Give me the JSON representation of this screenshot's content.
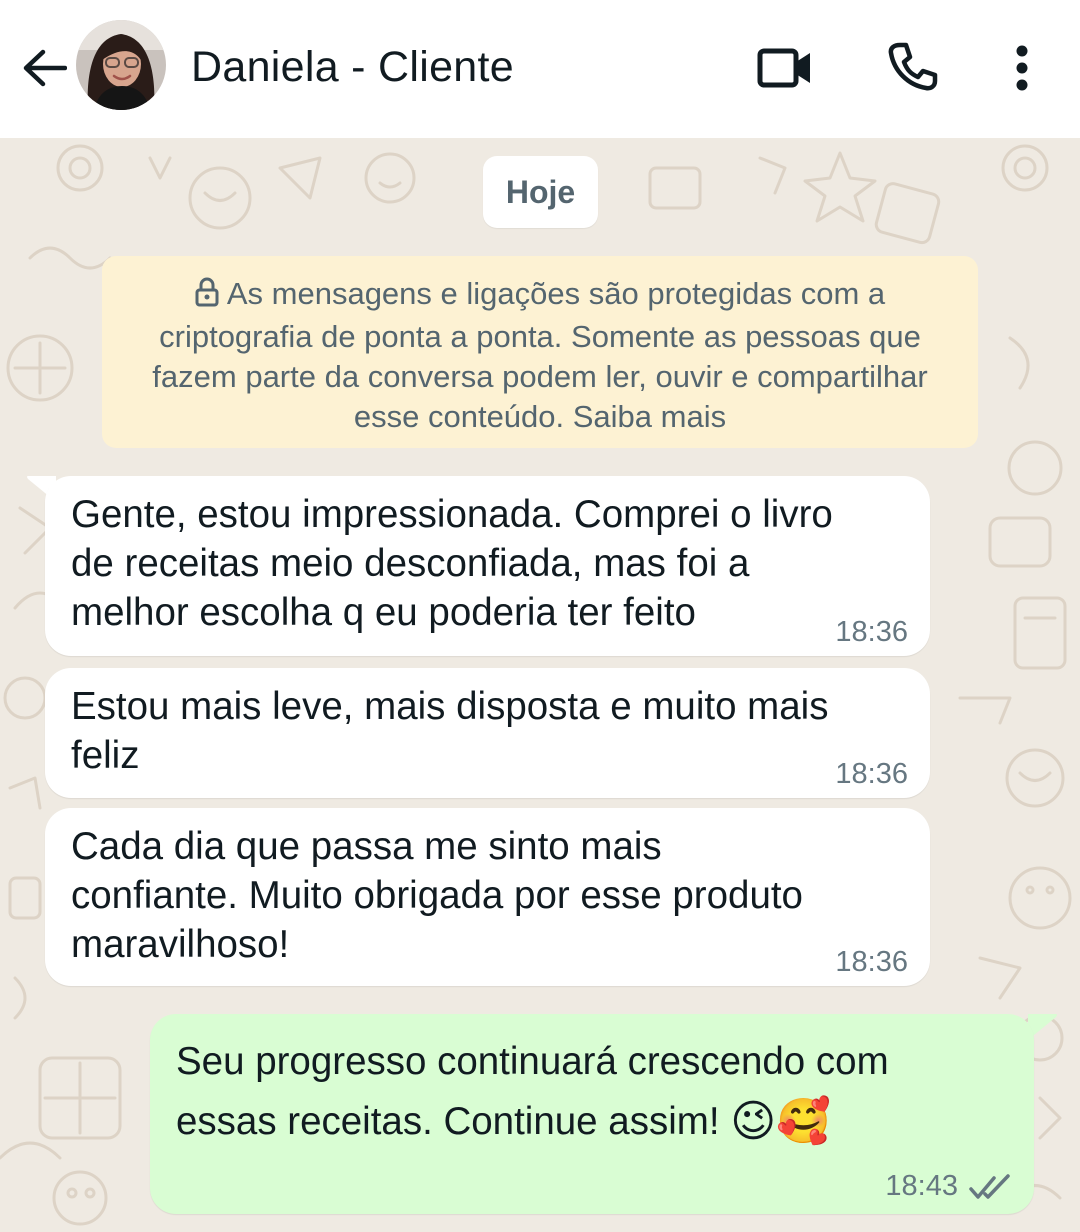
{
  "header": {
    "contact_name": "Daniela - Cliente",
    "icons": [
      "back-arrow-icon",
      "avatar",
      "video-call-icon",
      "phone-icon",
      "more-vertical-icon"
    ]
  },
  "chat": {
    "date_label": "Hoje",
    "encryption_notice": "As mensagens e ligações são protegidas com a criptografia de ponta a ponta. Somente as pessoas que fazem parte da conversa podem ler, ouvir e compartilhar esse conteúdo. Saiba mais",
    "messages": [
      {
        "direction": "incoming",
        "text": "Gente, estou impressionada. Comprei o livro\nde receitas meio desconfiada, mas foi a\nmelhor escolha q eu poderia ter feito",
        "time": "18:36"
      },
      {
        "direction": "incoming",
        "text": "Estou mais leve, mais disposta e muito mais\nfeliz",
        "time": "18:36"
      },
      {
        "direction": "incoming",
        "text": "Cada dia que passa me sinto mais\nconfiante. Muito obrigada por esse produto\nmaravilhoso!",
        "time": "18:36"
      },
      {
        "direction": "outgoing",
        "text": "Seu progresso continuará crescendo com\nessas receitas. Continue assim!",
        "emojis": "😉🥰",
        "time": "18:43",
        "status": "read"
      }
    ]
  },
  "colors": {
    "chat_background": "#efeae2",
    "outgoing_bubble": "#d9fdd3",
    "notice_background": "#fdf2d3",
    "read_ticks": "#667781"
  }
}
